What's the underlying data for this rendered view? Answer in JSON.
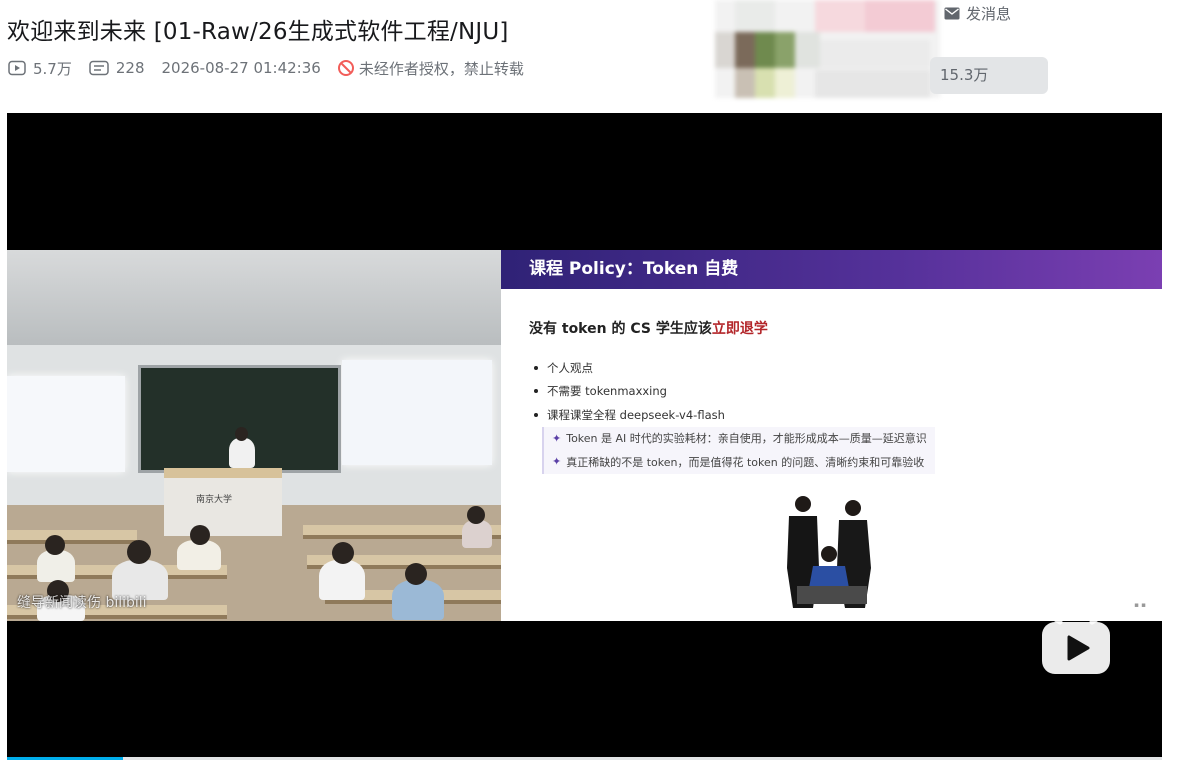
{
  "video": {
    "title": "欢迎来到未来 [01-Raw/26生成式软件工程/NJU]",
    "views": "5.7万",
    "danmaku": "228",
    "datetime": "2026-08-27 01:42:36",
    "copyright_notice": "未经作者授权，禁止转载"
  },
  "uploader": {
    "message_label": "发消息",
    "followers": "15.3万"
  },
  "player": {
    "watermark": "缝导新闻读伤 bilibili",
    "progress_fraction": 0.1
  },
  "slide": {
    "header": "课程 Policy：Token 自费",
    "heading_prefix": "没有 token 的 CS 学生应该",
    "heading_emphasis": "立即退学",
    "bullets": [
      "个人观点",
      "不需要 tokenmaxxing",
      "课程课堂全程 deepseek-v4-flash"
    ],
    "highlights": [
      "Token 是 AI 时代的实验耗材：亲自使用，才能形成成本—质量—延迟意识",
      "真正稀缺的不是 token，而是值得花 token 的问题、清晰约束和可靠验收"
    ],
    "podium_text": "南京大学"
  },
  "colors": {
    "slide_header_start": "#2f2276",
    "slide_header_end": "#7b3fb2",
    "emphasis_red": "#b3262a",
    "progress": "#00aeec"
  },
  "icons": [
    "play-count-icon",
    "danmaku-icon",
    "no-repost-icon",
    "mail-icon",
    "play-icon"
  ]
}
